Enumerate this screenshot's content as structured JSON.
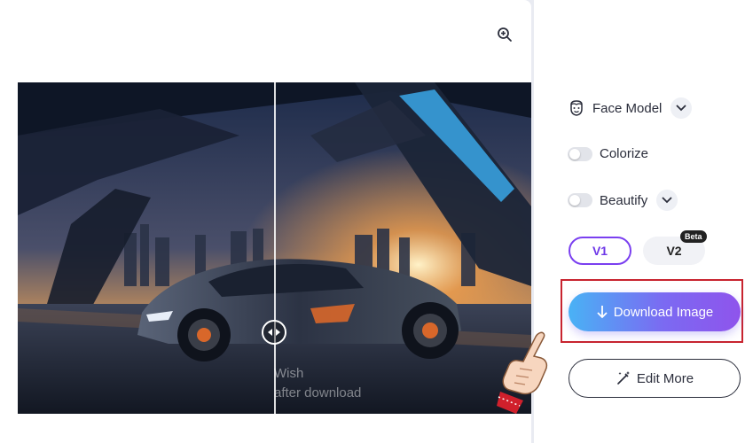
{
  "options": {
    "face_model_label": "Face Model",
    "colorize_label": "Colorize",
    "beautify_label": "Beautify"
  },
  "versions": {
    "v1_label": "V1",
    "v2_label": "V2",
    "beta_badge": "Beta",
    "selected": "V1"
  },
  "actions": {
    "download_label": "Download Image",
    "edit_label": "Edit More"
  },
  "preview": {
    "watermark_line1": "Wish",
    "watermark_line2": "after download"
  },
  "icons": {
    "zoom": "zoom-in-icon",
    "face": "face-icon",
    "download": "download-arrow-icon",
    "edit": "magic-wand-icon",
    "divider": "compare-arrows-icon",
    "pointer": "pointing-hand-icon"
  },
  "colors": {
    "accent": "#7a3ff0",
    "download_gradient_start": "#49b2f5",
    "download_gradient_end": "#8f54ec",
    "highlight": "#c8242f"
  },
  "toggles": {
    "colorize": false,
    "beautify": false
  }
}
